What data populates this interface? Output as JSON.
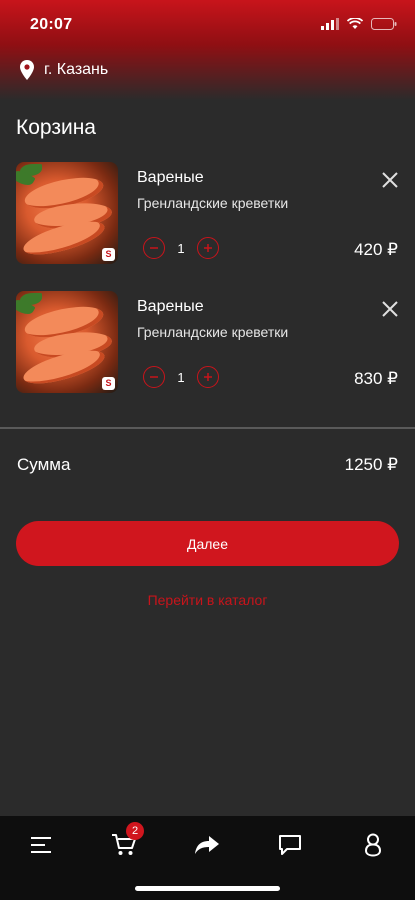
{
  "status_bar": {
    "time": "20:07"
  },
  "header": {
    "city": "г. Казань",
    "location_icon": "location-pin-icon"
  },
  "page": {
    "title": "Корзина"
  },
  "cart": {
    "items": [
      {
        "name": "Вареные",
        "description": "Гренландские креветки",
        "quantity": "1",
        "price": "420 ₽"
      },
      {
        "name": "Вареные",
        "description": "Гренландские креветки",
        "quantity": "1",
        "price": "830 ₽"
      }
    ],
    "sum_label": "Сумма",
    "sum_value": "1250 ₽"
  },
  "actions": {
    "next_label": "Далее",
    "catalog_link": "Перейти в каталог"
  },
  "tab_bar": {
    "cart_badge": "2",
    "tabs": [
      "menu-icon",
      "cart-icon",
      "share-icon",
      "chat-icon",
      "profile-icon"
    ]
  },
  "colors": {
    "accent": "#d0161e",
    "background": "#2b2b2b",
    "tab_bar": "#0e0e0e"
  }
}
